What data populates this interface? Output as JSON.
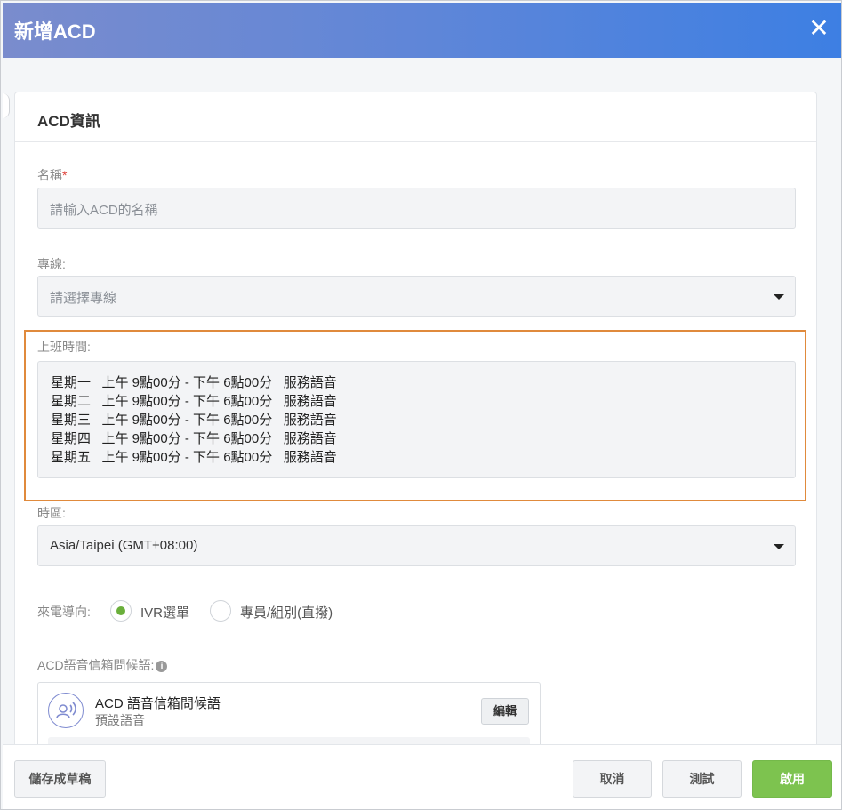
{
  "dialog": {
    "title": "新增ACD",
    "close_icon": "close-icon"
  },
  "section": {
    "title": "ACD資訊"
  },
  "name_field": {
    "label": "名稱",
    "required_mark": "*",
    "placeholder": "請輸入ACD的名稱",
    "value": ""
  },
  "line_field": {
    "label": "專線:",
    "placeholder": "請選擇專線"
  },
  "business_hours": {
    "label": "上班時間:",
    "rows": [
      "星期一   上午 9點00分 - 下午 6點00分   服務語音",
      "星期二   上午 9點00分 - 下午 6點00分   服務語音",
      "星期三   上午 9點00分 - 下午 6點00分   服務語音",
      "星期四   上午 9點00分 - 下午 6點00分   服務語音",
      "星期五   上午 9點00分 - 下午 6點00分   服務語音"
    ]
  },
  "timezone_field": {
    "label": "時區:",
    "value": "Asia/Taipei (GMT+08:00)"
  },
  "routing": {
    "label": "來電導向:",
    "options": [
      {
        "label": "IVR選單",
        "checked": true
      },
      {
        "label": "專員/組別(直撥)",
        "checked": false
      }
    ]
  },
  "voicemail": {
    "label": "ACD語音信箱問候語:",
    "info_icon": "i",
    "card_title": "ACD 語音信箱問候語",
    "card_subtitle": "預設語音",
    "edit_label": "編輯"
  },
  "footer": {
    "save_draft": "儲存成草稿",
    "cancel": "取消",
    "test": "測試",
    "enable": "啟用"
  },
  "colors": {
    "header_start": "#7a8ccd",
    "header_end": "#3d7fe3",
    "highlight_border": "#e08a3c",
    "primary_button": "#7dc34f",
    "radio_checked": "#6aaf3b"
  }
}
